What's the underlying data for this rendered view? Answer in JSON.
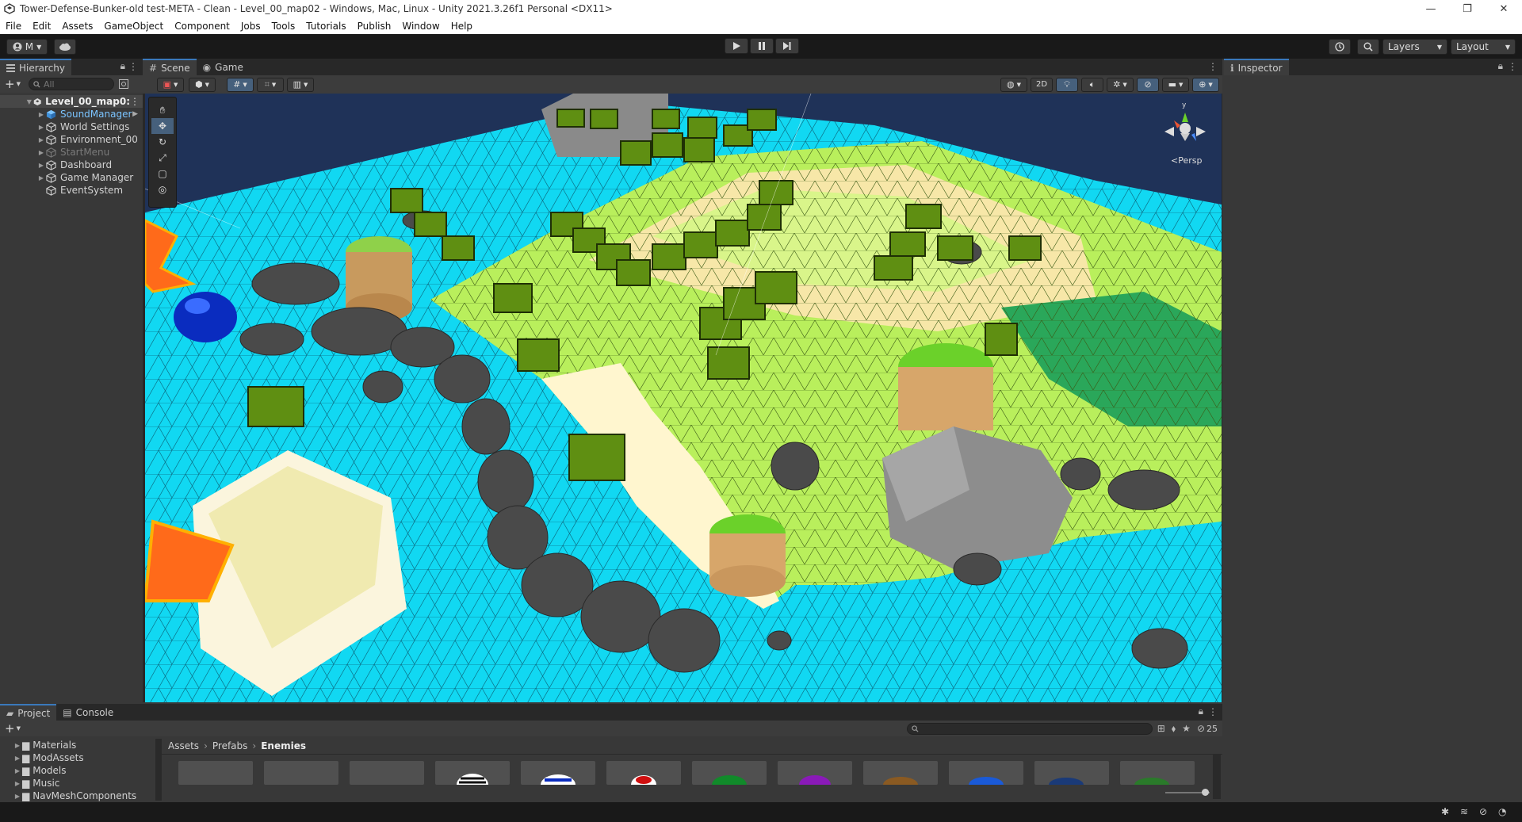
{
  "window": {
    "title": "Tower-Defense-Bunker-old test-META - Clean - Level_00_map02 - Windows, Mac, Linux - Unity 2021.3.26f1 Personal <DX11>",
    "minimize": "—",
    "maximize": "❐",
    "close": "✕"
  },
  "menu": [
    "File",
    "Edit",
    "Assets",
    "GameObject",
    "Component",
    "Jobs",
    "Tools",
    "Tutorials",
    "Publish",
    "Window",
    "Help"
  ],
  "toolbar": {
    "account_label": "M",
    "layers_label": "Layers",
    "layout_label": "Layout"
  },
  "hierarchy": {
    "tab_label": "Hierarchy",
    "search_placeholder": "All",
    "scene_name": "Level_00_map0:",
    "items": [
      {
        "label": "SoundManager",
        "style": "prefab"
      },
      {
        "label": "World Settings",
        "style": "normal"
      },
      {
        "label": "Environment_00",
        "style": "normal"
      },
      {
        "label": "StartMenu",
        "style": "disabled"
      },
      {
        "label": "Dashboard",
        "style": "normal"
      },
      {
        "label": "Game Manager",
        "style": "normal"
      },
      {
        "label": "EventSystem",
        "style": "normal"
      }
    ]
  },
  "scene": {
    "tabs": [
      "Scene",
      "Game"
    ],
    "mode_2d": "2D",
    "persp_label": "<Persp",
    "gizmo_y": "y",
    "colors": {
      "water": "#11d8f2",
      "grass_light": "#b9ef5c",
      "grass_dark": "#6bd12a",
      "sand": "#f7e7a8",
      "block": "#5f8f12",
      "rock": "#4a4a4a"
    }
  },
  "inspector": {
    "tab_label": "Inspector"
  },
  "project": {
    "tabs": [
      "Project",
      "Console"
    ],
    "folders": [
      "Materials",
      "ModAssets",
      "Models",
      "Music",
      "NavMeshComponents"
    ],
    "breadcrumb": [
      "Assets",
      "Prefabs",
      "Enemies"
    ],
    "hidden_count": "25"
  }
}
